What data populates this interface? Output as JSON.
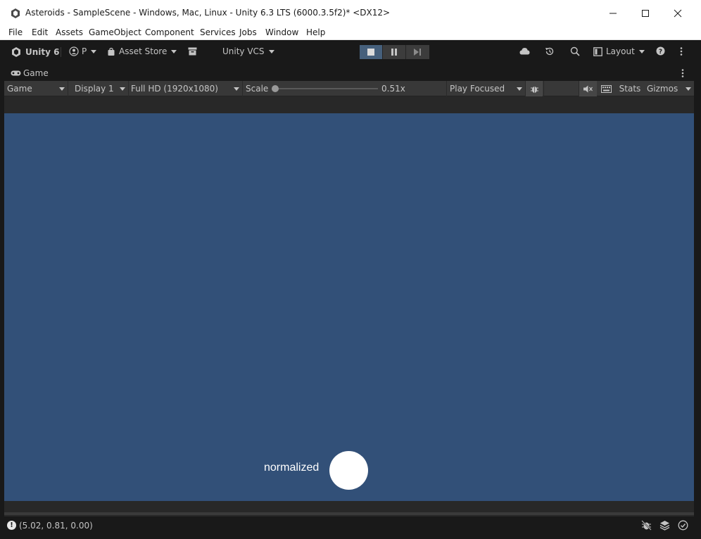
{
  "window": {
    "title": "Asteroids - SampleScene - Windows, Mac, Linux - Unity 6.3 LTS (6000.3.5f2)* <DX12>"
  },
  "menu": [
    "File",
    "Edit",
    "Assets",
    "GameObject",
    "Component",
    "Services",
    "Jobs",
    "Window",
    "Help"
  ],
  "toolbar": {
    "unity_label": "Unity 6",
    "account_label": "P",
    "asset_store_label": "Asset Store",
    "vcs_label": "Unity VCS",
    "layout_label": "Layout"
  },
  "game_tab": {
    "tab_label": "Game",
    "view_select": "Game",
    "display_select": "Display 1",
    "resolution_select": "Full HD (1920x1080)",
    "scale_label": "Scale",
    "scale_value": "0.51x",
    "play_mode_select": "Play Focused",
    "stats_label": "Stats",
    "gizmos_label": "Gizmos"
  },
  "scene": {
    "background_color": "#325078",
    "label_text": "normalized"
  },
  "status": {
    "message": "(5.02, 0.81, 0.00)"
  }
}
